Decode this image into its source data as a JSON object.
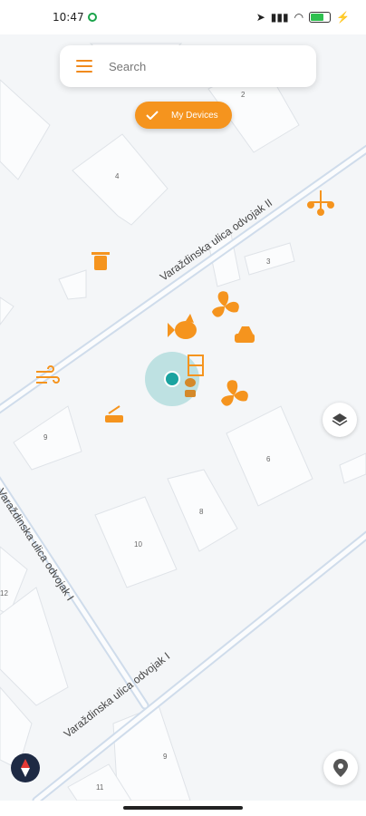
{
  "status_bar": {
    "time": "10:47",
    "battery": "80"
  },
  "search": {
    "placeholder": "Search"
  },
  "devices_button": {
    "label": "My Devices"
  },
  "map": {
    "street_labels": [
      "Varaždinska ulica odvojak II",
      "Varaždinska ulica odvojak I",
      "Varaždinska ulica odvojak I"
    ],
    "house_numbers": [
      "2",
      "4",
      "3",
      "9",
      "6",
      "8",
      "10",
      "9",
      "11",
      "12"
    ]
  },
  "colors": {
    "accent": "#f5941e",
    "location": "#1aa3a0",
    "road": "#cfdceb"
  },
  "icons": [
    "menu-icon",
    "check-icon",
    "layers-icon",
    "compass-icon",
    "location-pin-icon",
    "trash-icon",
    "fan-icon",
    "car-icon",
    "wind-icon",
    "router-icon",
    "fish-icon",
    "plant-icon",
    "door-icon",
    "antenna-icon"
  ]
}
